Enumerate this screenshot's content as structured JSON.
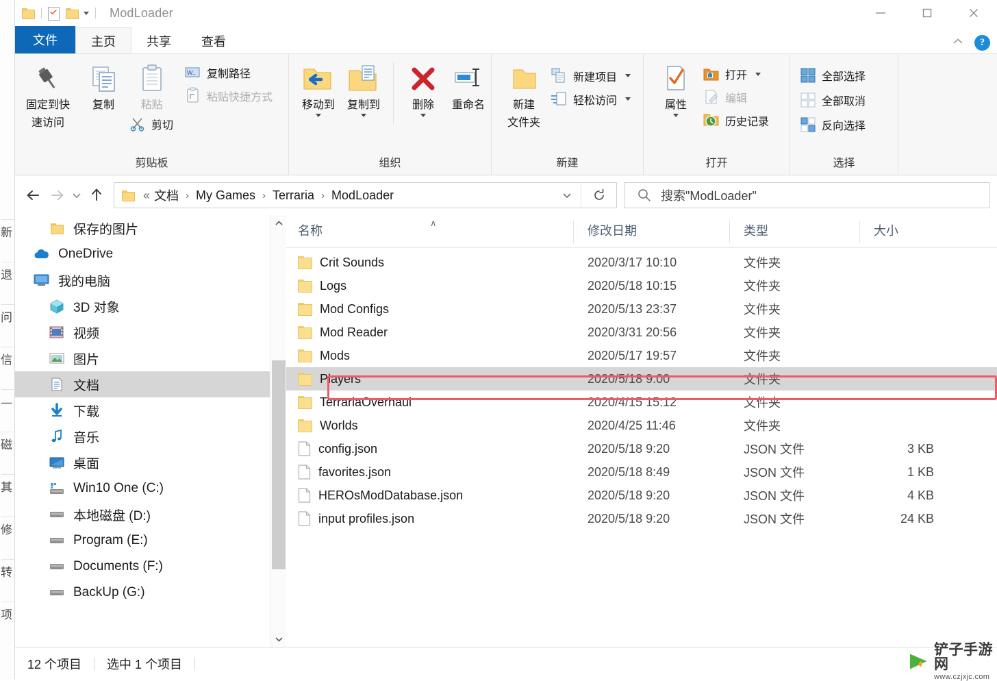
{
  "window": {
    "title": "ModLoader",
    "controls": {
      "minimize": "—",
      "maximize": "☐",
      "close": "✕"
    }
  },
  "quick_access": {
    "folder_icon": "folder-icon",
    "properties_icon": "properties-checkmark-icon",
    "new_folder_icon": "new-folder-icon",
    "customize_caret": "chevron-down-icon"
  },
  "ribbon": {
    "tabs": [
      {
        "label": "文件",
        "state": "file"
      },
      {
        "label": "主页",
        "state": "active"
      },
      {
        "label": "共享",
        "state": "normal"
      },
      {
        "label": "查看",
        "state": "normal"
      }
    ],
    "collapse_icon": "chevron-up-icon",
    "help_label": "?",
    "groups": [
      {
        "title": "剪贴板",
        "big_buttons": [
          {
            "label_line1": "固定到快",
            "label_line2": "速访问",
            "icon": "pin-icon",
            "dim": false
          },
          {
            "label_line1": "复制",
            "label_line2": "",
            "icon": "copy-icon",
            "dim": false
          },
          {
            "label_line1": "粘贴",
            "label_line2": "",
            "icon": "paste-clipboard-icon",
            "dim": true
          }
        ],
        "small_buttons": [
          {
            "label": "复制路径",
            "icon": "copy-path-icon",
            "dim": false
          },
          {
            "label": "粘贴快捷方式",
            "icon": "paste-shortcut-icon",
            "dim": true
          }
        ],
        "cut_button": {
          "label": "剪切",
          "icon": "scissors-icon"
        }
      },
      {
        "title": "组织",
        "big_buttons": [
          {
            "label_line1": "移动到",
            "label_line2": "",
            "icon": "move-to-icon",
            "caret": true
          },
          {
            "label_line1": "复制到",
            "label_line2": "",
            "icon": "copy-to-icon",
            "caret": true
          },
          {
            "label_line1": "删除",
            "label_line2": "",
            "icon": "delete-x-icon",
            "caret": true
          },
          {
            "label_line1": "重命名",
            "label_line2": "",
            "icon": "rename-icon",
            "caret": false
          }
        ]
      },
      {
        "title": "新建",
        "big_buttons": [
          {
            "label_line1": "新建",
            "label_line2": "文件夹",
            "icon": "new-folder-icon",
            "caret": false
          }
        ],
        "small_buttons": [
          {
            "label": "新建项目",
            "icon": "new-item-icon",
            "caret": true
          },
          {
            "label": "轻松访问",
            "icon": "easy-access-icon",
            "caret": true
          }
        ]
      },
      {
        "title": "打开",
        "big_buttons": [
          {
            "label_line1": "属性",
            "label_line2": "",
            "icon": "properties-checkmark-icon",
            "caret": true
          }
        ],
        "small_buttons": [
          {
            "label": "打开",
            "icon": "open-folder-icon",
            "caret": true,
            "dim": false
          },
          {
            "label": "编辑",
            "icon": "edit-icon",
            "caret": false,
            "dim": true
          },
          {
            "label": "历史记录",
            "icon": "history-icon",
            "caret": false,
            "dim": false
          }
        ]
      },
      {
        "title": "选择",
        "small_buttons": [
          {
            "label": "全部选择",
            "icon": "select-all-icon"
          },
          {
            "label": "全部取消",
            "icon": "select-none-icon"
          },
          {
            "label": "反向选择",
            "icon": "invert-selection-icon"
          }
        ]
      }
    ]
  },
  "navbar": {
    "back_icon": "arrow-left-icon",
    "forward_icon": "arrow-right-icon",
    "recent_icon": "chevron-down-icon",
    "up_icon": "arrow-up-icon",
    "breadcrumb_prefix": "«",
    "breadcrumb": [
      "文档",
      "My Games",
      "Terraria",
      "ModLoader"
    ],
    "breadcrumb_separator": "›",
    "dropdown_icon": "chevron-down-icon",
    "refresh_icon": "refresh-icon"
  },
  "search": {
    "icon": "search-icon",
    "placeholder": "搜索\"ModLoader\""
  },
  "sidebar": {
    "items": [
      {
        "label": "保存的图片",
        "icon": "folder-icon",
        "indent": 1,
        "selected": false
      },
      {
        "label": "OneDrive",
        "icon": "onedrive-cloud-icon",
        "indent": 0,
        "selected": false
      },
      {
        "label": "我的电脑",
        "icon": "this-pc-monitor-icon",
        "indent": 0,
        "selected": false
      },
      {
        "label": "3D 对象",
        "icon": "3d-objects-icon",
        "indent": 1,
        "selected": false
      },
      {
        "label": "视频",
        "icon": "videos-icon",
        "indent": 1,
        "selected": false
      },
      {
        "label": "图片",
        "icon": "pictures-icon",
        "indent": 1,
        "selected": false
      },
      {
        "label": "文档",
        "icon": "documents-icon",
        "indent": 1,
        "selected": true
      },
      {
        "label": "下载",
        "icon": "downloads-arrow-icon",
        "indent": 1,
        "selected": false
      },
      {
        "label": "音乐",
        "icon": "music-note-icon",
        "indent": 1,
        "selected": false
      },
      {
        "label": "桌面",
        "icon": "desktop-icon",
        "indent": 1,
        "selected": false
      },
      {
        "label": "Win10 One (C:)",
        "icon": "system-drive-icon",
        "indent": 1,
        "selected": false
      },
      {
        "label": "本地磁盘 (D:)",
        "icon": "drive-icon",
        "indent": 1,
        "selected": false
      },
      {
        "label": "Program (E:)",
        "icon": "drive-icon",
        "indent": 1,
        "selected": false
      },
      {
        "label": "Documents (F:)",
        "icon": "drive-icon",
        "indent": 1,
        "selected": false
      },
      {
        "label": "BackUp (G:)",
        "icon": "drive-icon",
        "indent": 1,
        "selected": false
      }
    ],
    "scroll_up_icon": "chevron-up-icon",
    "scroll_down_icon": "chevron-down-icon"
  },
  "filelist": {
    "columns": [
      {
        "label": "名称",
        "sorted": true,
        "sort_arrow": "∧"
      },
      {
        "label": "修改日期",
        "sorted": false
      },
      {
        "label": "类型",
        "sorted": false
      },
      {
        "label": "大小",
        "sorted": false
      }
    ],
    "rows": [
      {
        "name": "Crit Sounds",
        "date": "2020/3/17 10:10",
        "type": "文件夹",
        "size": "",
        "icon": "folder-icon",
        "selected": false
      },
      {
        "name": "Logs",
        "date": "2020/5/18 10:15",
        "type": "文件夹",
        "size": "",
        "icon": "folder-icon",
        "selected": false
      },
      {
        "name": "Mod Configs",
        "date": "2020/5/13 23:37",
        "type": "文件夹",
        "size": "",
        "icon": "folder-icon",
        "selected": false
      },
      {
        "name": "Mod Reader",
        "date": "2020/3/31 20:56",
        "type": "文件夹",
        "size": "",
        "icon": "folder-icon",
        "selected": false
      },
      {
        "name": "Mods",
        "date": "2020/5/17 19:57",
        "type": "文件夹",
        "size": "",
        "icon": "folder-icon",
        "selected": false
      },
      {
        "name": "Players",
        "date": "2020/5/18 9:00",
        "type": "文件夹",
        "size": "",
        "icon": "folder-icon",
        "selected": true
      },
      {
        "name": "TerrariaOverhaul",
        "date": "2020/4/15 15:12",
        "type": "文件夹",
        "size": "",
        "icon": "folder-icon",
        "selected": false
      },
      {
        "name": "Worlds",
        "date": "2020/4/25 11:46",
        "type": "文件夹",
        "size": "",
        "icon": "folder-icon",
        "selected": false
      },
      {
        "name": "config.json",
        "date": "2020/5/18 9:20",
        "type": "JSON 文件",
        "size": "3 KB",
        "icon": "file-icon",
        "selected": false
      },
      {
        "name": "favorites.json",
        "date": "2020/5/18 8:49",
        "type": "JSON 文件",
        "size": "1 KB",
        "icon": "file-icon",
        "selected": false
      },
      {
        "name": "HEROsModDatabase.json",
        "date": "2020/5/18 9:20",
        "type": "JSON 文件",
        "size": "4 KB",
        "icon": "file-icon",
        "selected": false
      },
      {
        "name": "input profiles.json",
        "date": "2020/5/18 9:20",
        "type": "JSON 文件",
        "size": "24 KB",
        "icon": "file-icon",
        "selected": false
      }
    ]
  },
  "annotation": {
    "color": "#ef5b62",
    "target_row": "Players"
  },
  "statusbar": {
    "item_count": "12 个项目",
    "selected_count": "选中 1 个项目"
  },
  "watermark": {
    "name": "铲子手游网",
    "url": "www.czjxjc.com",
    "logo_color": "#4caf3e"
  },
  "behind_window": {
    "chars": [
      "新",
      "退",
      "问",
      "信",
      "—",
      "磁",
      "其",
      "修",
      "转",
      "项"
    ]
  }
}
